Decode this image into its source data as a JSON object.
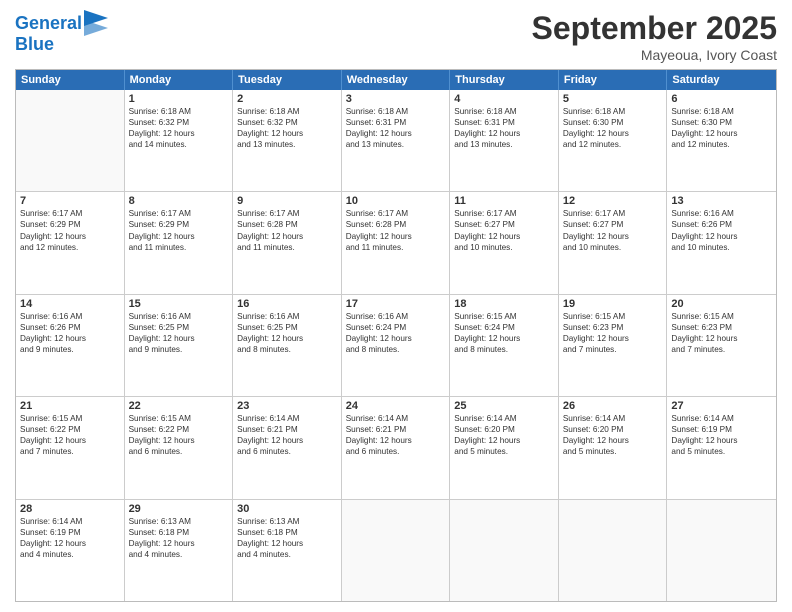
{
  "header": {
    "logo_line1": "General",
    "logo_line2": "Blue",
    "month": "September 2025",
    "location": "Mayeoua, Ivory Coast"
  },
  "days_of_week": [
    "Sunday",
    "Monday",
    "Tuesday",
    "Wednesday",
    "Thursday",
    "Friday",
    "Saturday"
  ],
  "weeks": [
    [
      {
        "day": "",
        "info": ""
      },
      {
        "day": "1",
        "info": "Sunrise: 6:18 AM\nSunset: 6:32 PM\nDaylight: 12 hours\nand 14 minutes."
      },
      {
        "day": "2",
        "info": "Sunrise: 6:18 AM\nSunset: 6:32 PM\nDaylight: 12 hours\nand 13 minutes."
      },
      {
        "day": "3",
        "info": "Sunrise: 6:18 AM\nSunset: 6:31 PM\nDaylight: 12 hours\nand 13 minutes."
      },
      {
        "day": "4",
        "info": "Sunrise: 6:18 AM\nSunset: 6:31 PM\nDaylight: 12 hours\nand 13 minutes."
      },
      {
        "day": "5",
        "info": "Sunrise: 6:18 AM\nSunset: 6:30 PM\nDaylight: 12 hours\nand 12 minutes."
      },
      {
        "day": "6",
        "info": "Sunrise: 6:18 AM\nSunset: 6:30 PM\nDaylight: 12 hours\nand 12 minutes."
      }
    ],
    [
      {
        "day": "7",
        "info": "Sunrise: 6:17 AM\nSunset: 6:29 PM\nDaylight: 12 hours\nand 12 minutes."
      },
      {
        "day": "8",
        "info": "Sunrise: 6:17 AM\nSunset: 6:29 PM\nDaylight: 12 hours\nand 11 minutes."
      },
      {
        "day": "9",
        "info": "Sunrise: 6:17 AM\nSunset: 6:28 PM\nDaylight: 12 hours\nand 11 minutes."
      },
      {
        "day": "10",
        "info": "Sunrise: 6:17 AM\nSunset: 6:28 PM\nDaylight: 12 hours\nand 11 minutes."
      },
      {
        "day": "11",
        "info": "Sunrise: 6:17 AM\nSunset: 6:27 PM\nDaylight: 12 hours\nand 10 minutes."
      },
      {
        "day": "12",
        "info": "Sunrise: 6:17 AM\nSunset: 6:27 PM\nDaylight: 12 hours\nand 10 minutes."
      },
      {
        "day": "13",
        "info": "Sunrise: 6:16 AM\nSunset: 6:26 PM\nDaylight: 12 hours\nand 10 minutes."
      }
    ],
    [
      {
        "day": "14",
        "info": "Sunrise: 6:16 AM\nSunset: 6:26 PM\nDaylight: 12 hours\nand 9 minutes."
      },
      {
        "day": "15",
        "info": "Sunrise: 6:16 AM\nSunset: 6:25 PM\nDaylight: 12 hours\nand 9 minutes."
      },
      {
        "day": "16",
        "info": "Sunrise: 6:16 AM\nSunset: 6:25 PM\nDaylight: 12 hours\nand 8 minutes."
      },
      {
        "day": "17",
        "info": "Sunrise: 6:16 AM\nSunset: 6:24 PM\nDaylight: 12 hours\nand 8 minutes."
      },
      {
        "day": "18",
        "info": "Sunrise: 6:15 AM\nSunset: 6:24 PM\nDaylight: 12 hours\nand 8 minutes."
      },
      {
        "day": "19",
        "info": "Sunrise: 6:15 AM\nSunset: 6:23 PM\nDaylight: 12 hours\nand 7 minutes."
      },
      {
        "day": "20",
        "info": "Sunrise: 6:15 AM\nSunset: 6:23 PM\nDaylight: 12 hours\nand 7 minutes."
      }
    ],
    [
      {
        "day": "21",
        "info": "Sunrise: 6:15 AM\nSunset: 6:22 PM\nDaylight: 12 hours\nand 7 minutes."
      },
      {
        "day": "22",
        "info": "Sunrise: 6:15 AM\nSunset: 6:22 PM\nDaylight: 12 hours\nand 6 minutes."
      },
      {
        "day": "23",
        "info": "Sunrise: 6:14 AM\nSunset: 6:21 PM\nDaylight: 12 hours\nand 6 minutes."
      },
      {
        "day": "24",
        "info": "Sunrise: 6:14 AM\nSunset: 6:21 PM\nDaylight: 12 hours\nand 6 minutes."
      },
      {
        "day": "25",
        "info": "Sunrise: 6:14 AM\nSunset: 6:20 PM\nDaylight: 12 hours\nand 5 minutes."
      },
      {
        "day": "26",
        "info": "Sunrise: 6:14 AM\nSunset: 6:20 PM\nDaylight: 12 hours\nand 5 minutes."
      },
      {
        "day": "27",
        "info": "Sunrise: 6:14 AM\nSunset: 6:19 PM\nDaylight: 12 hours\nand 5 minutes."
      }
    ],
    [
      {
        "day": "28",
        "info": "Sunrise: 6:14 AM\nSunset: 6:19 PM\nDaylight: 12 hours\nand 4 minutes."
      },
      {
        "day": "29",
        "info": "Sunrise: 6:13 AM\nSunset: 6:18 PM\nDaylight: 12 hours\nand 4 minutes."
      },
      {
        "day": "30",
        "info": "Sunrise: 6:13 AM\nSunset: 6:18 PM\nDaylight: 12 hours\nand 4 minutes."
      },
      {
        "day": "",
        "info": ""
      },
      {
        "day": "",
        "info": ""
      },
      {
        "day": "",
        "info": ""
      },
      {
        "day": "",
        "info": ""
      }
    ]
  ]
}
